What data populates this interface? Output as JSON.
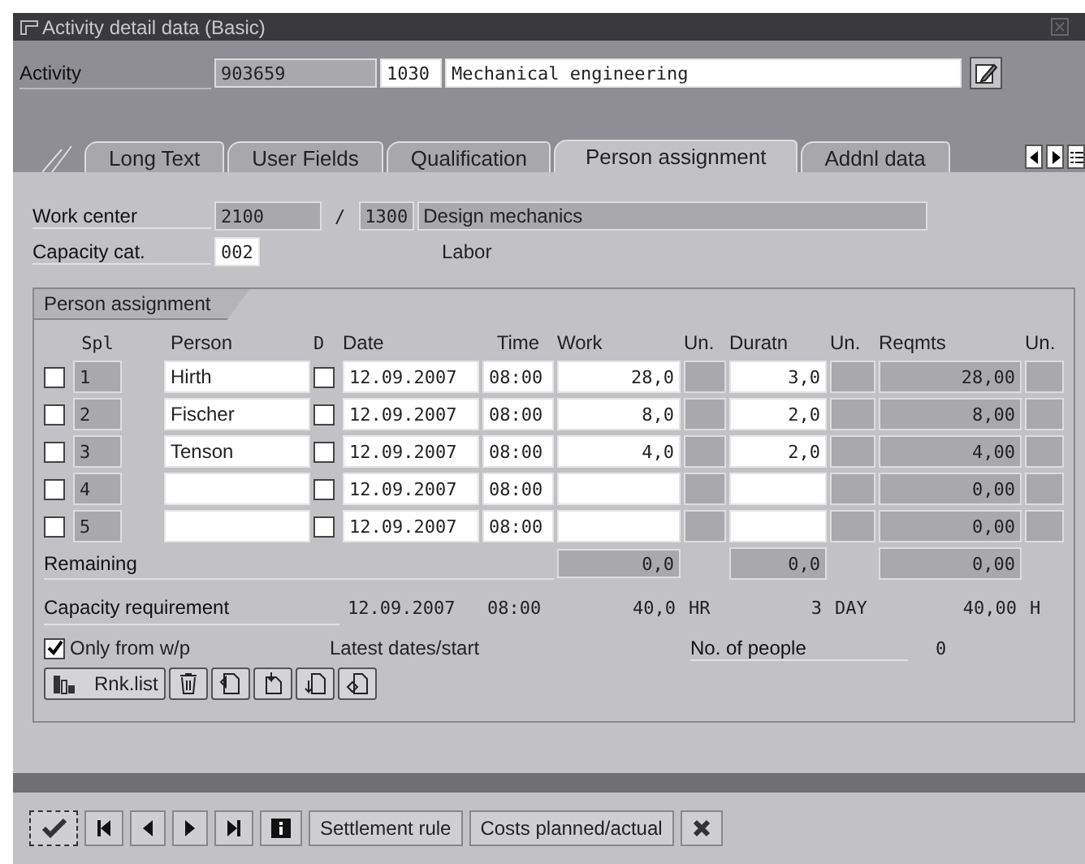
{
  "window": {
    "title": "Activity detail data (Basic)"
  },
  "activity": {
    "label": "Activity",
    "number": "903659",
    "code": "1030",
    "description": "Mechanical engineering"
  },
  "tabs": [
    {
      "label": "Long Text",
      "selected": false
    },
    {
      "label": "User Fields",
      "selected": false
    },
    {
      "label": "Qualification",
      "selected": false
    },
    {
      "label": "Person assignment",
      "selected": true
    },
    {
      "label": "Addnl data",
      "selected": false
    }
  ],
  "work_center": {
    "label": "Work center",
    "plant": "2100",
    "separator": "/",
    "code": "1300",
    "description": "Design mechanics"
  },
  "capacity_cat": {
    "label": "Capacity cat.",
    "value": "002",
    "description": "Labor"
  },
  "group": {
    "title": "Person assignment",
    "columns": [
      "Spl",
      "Person",
      "D",
      "Date",
      "Time",
      "Work",
      "Un.",
      "Duratn",
      "Un.",
      "Reqmts",
      "Un."
    ],
    "rows": [
      {
        "checked": false,
        "spl": "1",
        "person": "Hirth",
        "d_checked": false,
        "date": "12.09.2007",
        "time": "08:00",
        "work": "28,0",
        "duration": "3,0",
        "reqmts": "28,00"
      },
      {
        "checked": false,
        "spl": "2",
        "person": "Fischer",
        "d_checked": false,
        "date": "12.09.2007",
        "time": "08:00",
        "work": "8,0",
        "duration": "2,0",
        "reqmts": "8,00"
      },
      {
        "checked": false,
        "spl": "3",
        "person": "Tenson",
        "d_checked": false,
        "date": "12.09.2007",
        "time": "08:00",
        "work": "4,0",
        "duration": "2,0",
        "reqmts": "4,00"
      },
      {
        "checked": false,
        "spl": "4",
        "d_checked": false,
        "date": "12.09.2007",
        "time": "08:00",
        "reqmts": "0,00"
      },
      {
        "checked": false,
        "spl": "5",
        "d_checked": false,
        "date": "12.09.2007",
        "time": "08:00",
        "reqmts": "0,00"
      }
    ],
    "remaining": {
      "label": "Remaining",
      "work": "0,0",
      "duration": "0,0",
      "reqmts": "0,00"
    },
    "capacity_requirement": {
      "label": "Capacity requirement",
      "date": "12.09.2007",
      "time": "08:00",
      "work": "40,0",
      "work_unit": "HR",
      "duration": "3",
      "duration_unit": "DAY",
      "reqmts": "40,00",
      "reqmts_unit": "H"
    },
    "only_from_wp": {
      "label": "Only from w/p",
      "checked": true
    },
    "latest_dates": "Latest dates/start",
    "people": {
      "label": "No. of people",
      "value": "0"
    },
    "rank_button": "Rnk.list"
  },
  "footer": {
    "buttons": [
      "Settlement rule",
      "Costs planned/actual"
    ]
  }
}
